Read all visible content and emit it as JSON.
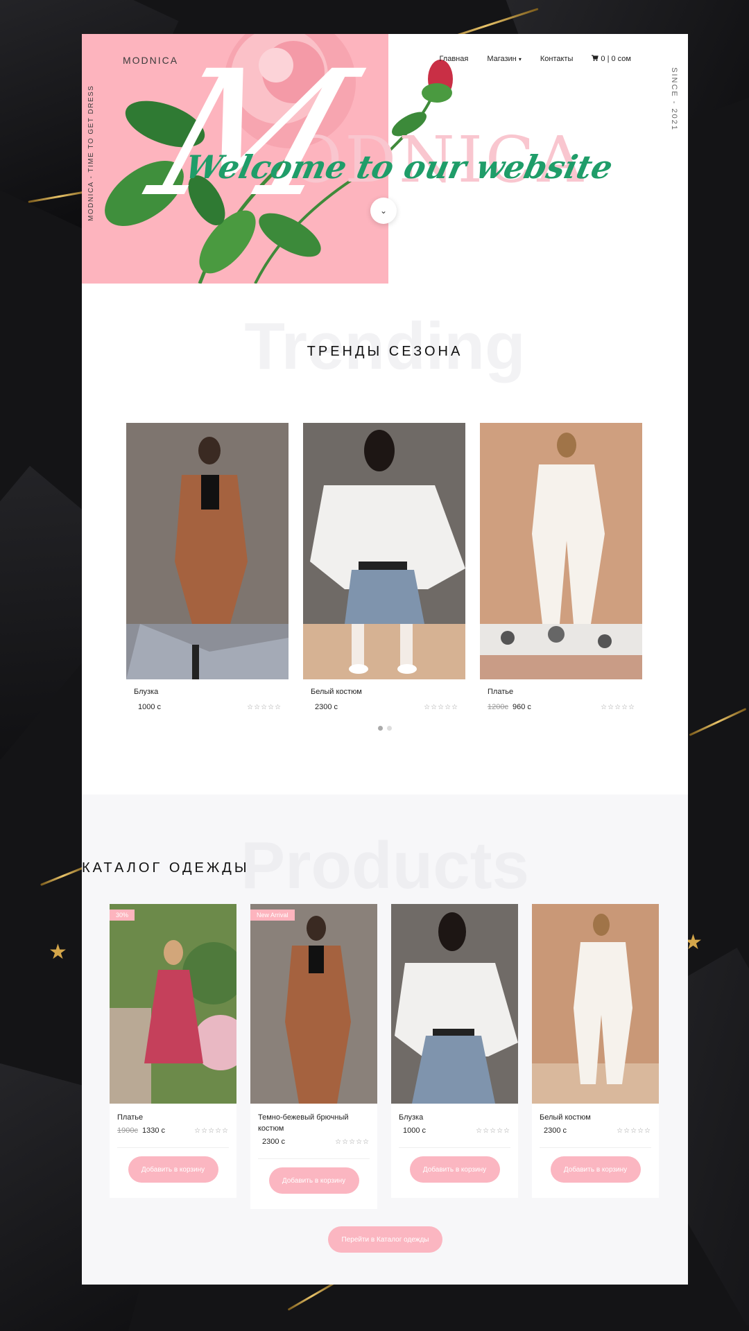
{
  "header": {
    "brand": "MODNICA",
    "side_text": "MODNICA - TIME TO GET DRESS",
    "since_text": "SINCE - 2021",
    "hero_word": "ODNICA",
    "hero_letter": "M",
    "welcome": "Welcome to our website",
    "nav": [
      {
        "label": "Главная"
      },
      {
        "label": "Магазин",
        "dropdown": true
      },
      {
        "label": "Контакты"
      }
    ],
    "cart": {
      "icon": "cart-icon",
      "label": "0 | 0 сом"
    },
    "caret": "▾",
    "scroll_icon": "⌄"
  },
  "trending": {
    "bg_word": "Trending",
    "title": "ТРЕНДЫ СЕЗОНА",
    "items": [
      {
        "name": "Блузка",
        "price": "1000 с",
        "old_price": "",
        "rating": "☆☆☆☆☆"
      },
      {
        "name": "Белый костюм",
        "price": "2300 с",
        "old_price": "",
        "rating": "☆☆☆☆☆"
      },
      {
        "name": "Платье",
        "price": "960 с",
        "old_price": "1200с",
        "rating": "☆☆☆☆☆"
      }
    ]
  },
  "products": {
    "bg_word": "Products",
    "title": "КАТАЛОГ ОДЕЖДЫ",
    "items": [
      {
        "name": "Платье",
        "price": "1330 с",
        "old_price": "1900с",
        "tag": "30%",
        "rating": "☆☆☆☆☆",
        "button": "Добавить в корзину"
      },
      {
        "name": "Темно-бежевый брючный костюм",
        "price": "2300 с",
        "old_price": "",
        "tag": "New Arrival",
        "rating": "☆☆☆☆☆",
        "button": "Добавить в корзину"
      },
      {
        "name": "Блузка",
        "price": "1000 с",
        "old_price": "",
        "tag": "",
        "rating": "☆☆☆☆☆",
        "button": "Добавить в корзину"
      },
      {
        "name": "Белый костюм",
        "price": "2300 с",
        "old_price": "",
        "tag": "",
        "rating": "☆☆☆☆☆",
        "button": "Добавить в корзину"
      }
    ],
    "catalog_button": "Перейти в Каталог одежды"
  },
  "colors": {
    "pink": "#fdb4be",
    "green_script": "#1f9d69",
    "button_pink": "#fbb6c1",
    "backdrop": "#141416"
  }
}
